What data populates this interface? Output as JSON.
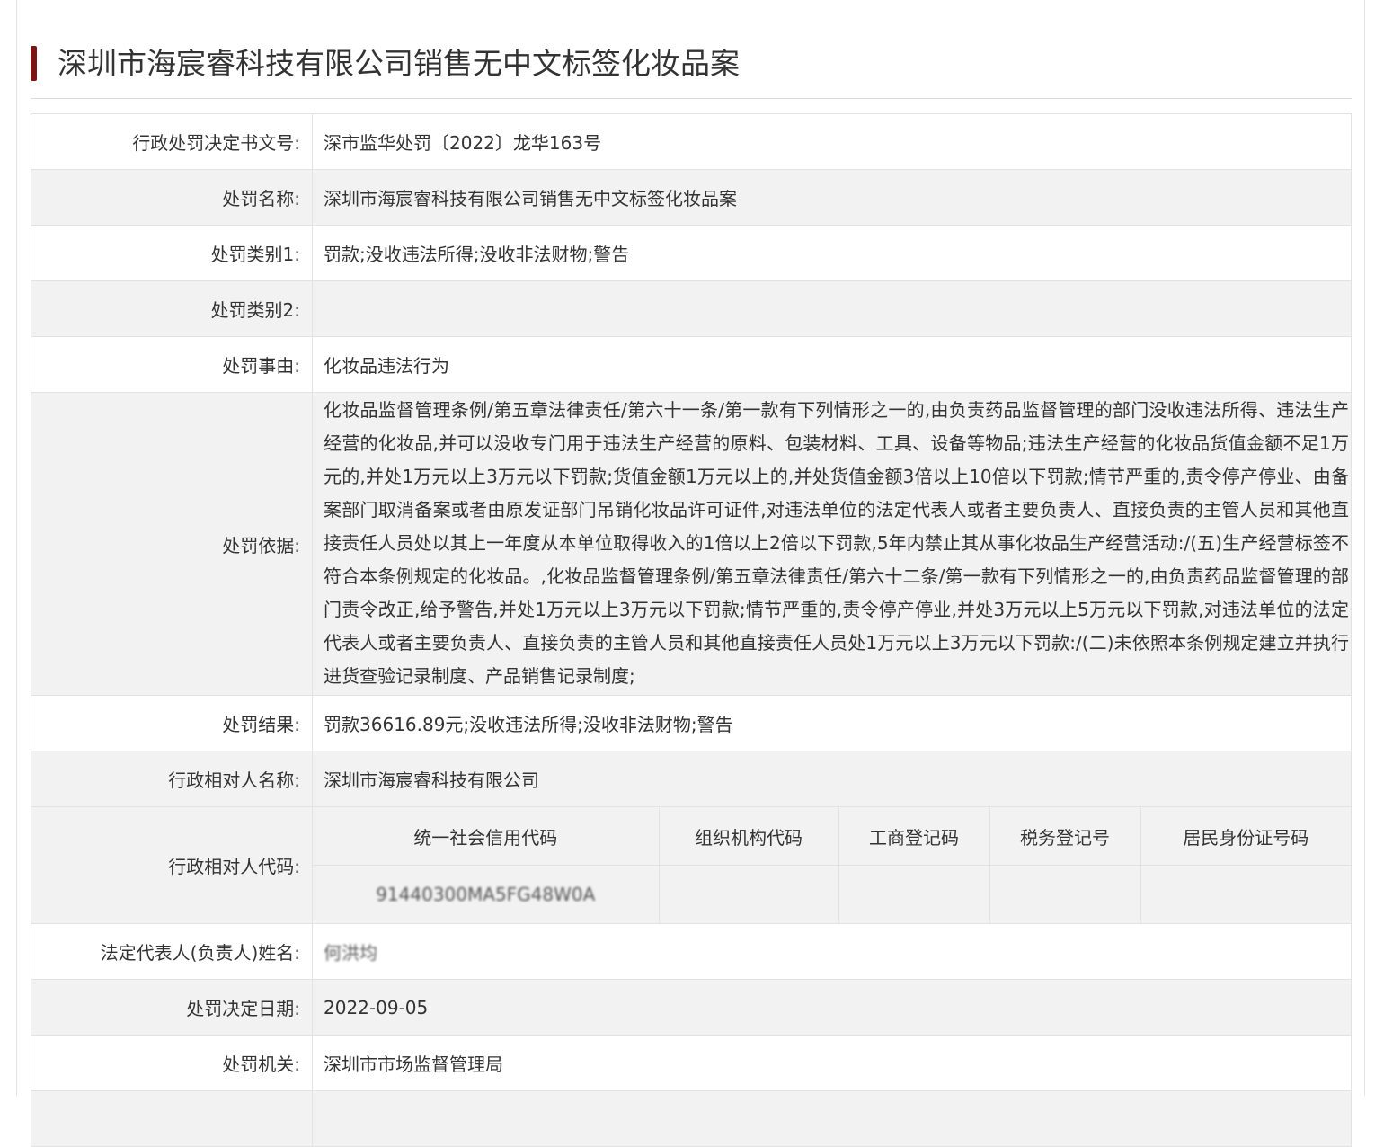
{
  "page_title": "深圳市海宸睿科技有限公司销售无中文标签化妆品案",
  "rows": [
    {
      "label": "行政处罚决定书文号:",
      "value": "深市监华处罚〔2022〕龙华163号"
    },
    {
      "label": "处罚名称:",
      "value": "深圳市海宸睿科技有限公司销售无中文标签化妆品案"
    },
    {
      "label": "处罚类别1:",
      "value": "罚款;没收违法所得;没收非法财物;警告"
    },
    {
      "label": "处罚类别2:",
      "value": ""
    },
    {
      "label": "处罚事由:",
      "value": "化妆品违法行为"
    },
    {
      "label": "处罚依据:",
      "value": "化妆品监督管理条例/第五章法律责任/第六十一条/第一款有下列情形之一的,由负责药品监督管理的部门没收违法所得、违法生产经营的化妆品,并可以没收专门用于违法生产经营的原料、包装材料、工具、设备等物品;违法生产经营的化妆品货值金额不足1万元的,并处1万元以上3万元以下罚款;货值金额1万元以上的,并处货值金额3倍以上10倍以下罚款;情节严重的,责令停产停业、由备案部门取消备案或者由原发证部门吊销化妆品许可证件,对违法单位的法定代表人或者主要负责人、直接负责的主管人员和其他直接责任人员处以其上一年度从本单位取得收入的1倍以上2倍以下罚款,5年内禁止其从事化妆品生产经营活动:/(五)生产经营标签不符合本条例规定的化妆品。,化妆品监督管理条例/第五章法律责任/第六十二条/第一款有下列情形之一的,由负责药品监督管理的部门责令改正,给予警告,并处1万元以上3万元以下罚款;情节严重的,责令停产停业,并处3万元以上5万元以下罚款,对违法单位的法定代表人或者主要负责人、直接负责的主管人员和其他直接责任人员处1万元以上3万元以下罚款:/(二)未依照本条例规定建立并执行进货查验记录制度、产品销售记录制度;"
    },
    {
      "label": "处罚结果:",
      "value": "罚款36616.89元;没收违法所得;没收非法财物;警告"
    },
    {
      "label": "行政相对人名称:",
      "value": "深圳市海宸睿科技有限公司"
    }
  ],
  "codes": {
    "label": "行政相对人代码:",
    "headers": [
      "统一社会信用代码",
      "组织机构代码",
      "工商登记码",
      "税务登记号",
      "居民身份证号码"
    ],
    "values": [
      "91440300MA5FG48W0A",
      "",
      "",
      "",
      ""
    ]
  },
  "rows_after": [
    {
      "label": "法定代表人(负责人)姓名:",
      "value": "何洪均"
    },
    {
      "label": "处罚决定日期:",
      "value": "2022-09-05"
    },
    {
      "label": "处罚机关:",
      "value": "深圳市市场监督管理局"
    }
  ]
}
